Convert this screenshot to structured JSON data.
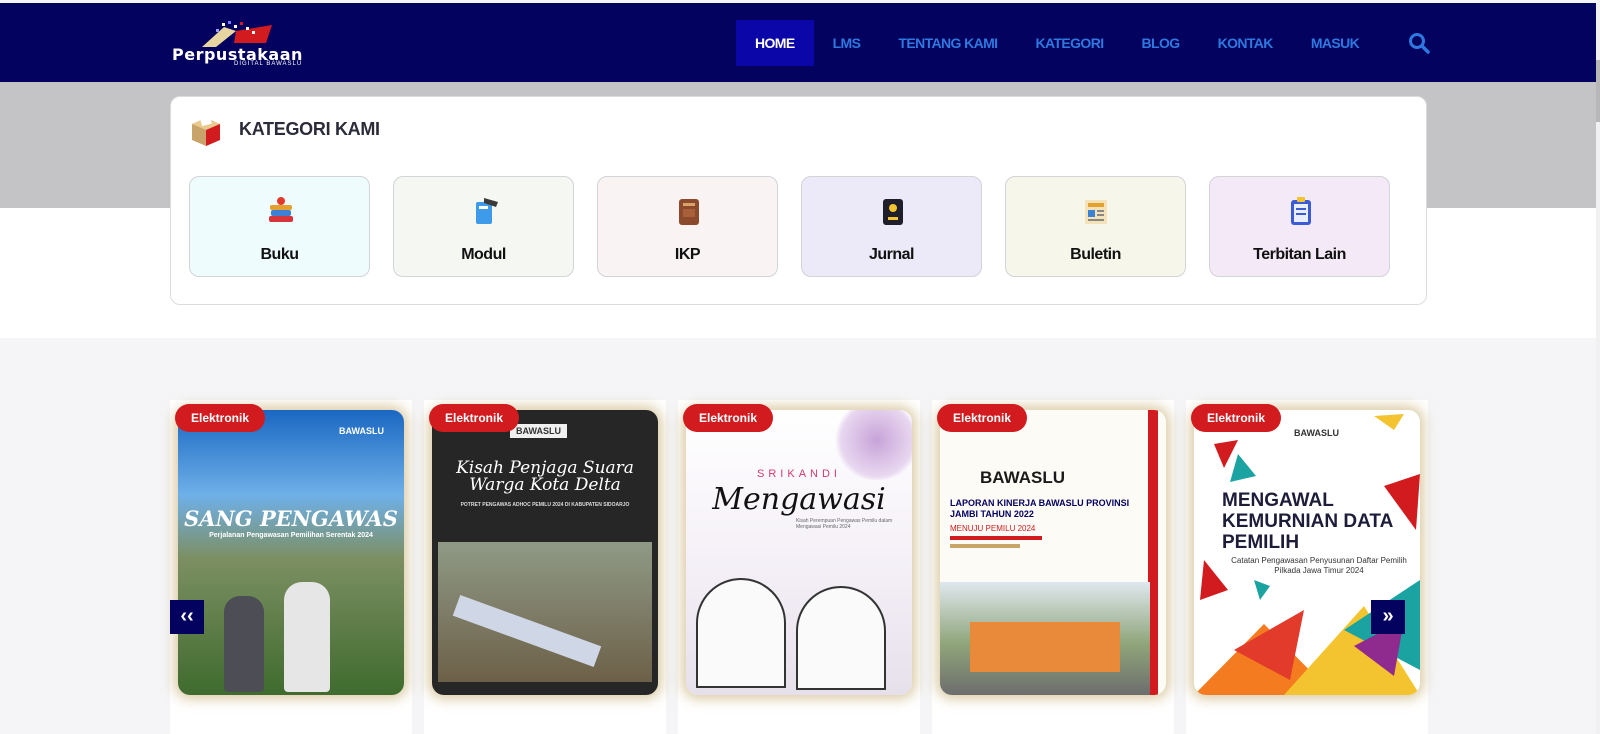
{
  "brand": {
    "name": "Perpustakaan",
    "subtitle": "DIGITAL BAWASLU"
  },
  "nav": {
    "items": [
      "HOME",
      "LMS",
      "TENTANG KAMI",
      "KATEGORI",
      "BLOG",
      "KONTAK",
      "MASUK"
    ],
    "active": "HOME",
    "search_icon": "search-icon"
  },
  "kategori": {
    "title": "KATEGORI KAMI",
    "icon": "ballot-box-icon",
    "items": [
      {
        "label": "Buku",
        "icon": "stacked-books-icon",
        "bg": "#eefcfd"
      },
      {
        "label": "Modul",
        "icon": "module-book-icon",
        "bg": "#f4f7f2"
      },
      {
        "label": "IKP",
        "icon": "brown-book-icon",
        "bg": "#faf3f4"
      },
      {
        "label": "Jurnal",
        "icon": "journal-icon",
        "bg": "#ece9f8"
      },
      {
        "label": "Buletin",
        "icon": "newspaper-icon",
        "bg": "#f6f7ea"
      },
      {
        "label": "Terbitan Lain",
        "icon": "clipboard-icon",
        "bg": "#f4e9f6"
      }
    ]
  },
  "books": {
    "badge": "Elektronik",
    "items": [
      {
        "title": "SANG PENGAWAS",
        "subtitle": "Perjalanan Pengawasan Pemilihan Serentak 2024",
        "brand": "BAWASLU"
      },
      {
        "title": "Kisah Penjaga Suara Warga Kota Delta",
        "subtitle": "POTRET PENGAWAS ADHOC PEMILU 2024 DI KABUPATEN SIDOARJO",
        "brand": "BAWASLU"
      },
      {
        "title": "Mengawasi",
        "kicker": "SRIKANDI",
        "subtitle": "Kisah Perempuan Pengawas Pemilu dalam Mengawasi Pemilu 2024"
      },
      {
        "title": "LAPORAN KINERJA BAWASLU PROVINSI JAMBI TAHUN 2022",
        "subtitle": "MENUJU PEMILU 2024",
        "brand": "BAWASLU"
      },
      {
        "title": "MENGAWAL KEMURNIAN DATA PEMILIH",
        "subtitle": "Catatan Pengawasan Penyusunan Daftar Pemilih Pilkada Jawa Timur 2024",
        "brand": "BAWASLU"
      }
    ],
    "prev_label": "‹‹",
    "next_label": "»"
  },
  "colors": {
    "header": "#04025f",
    "nav_link": "#2f78e0",
    "nav_active": "#0b06a8",
    "badge": "#d21b1f",
    "band": "#c4c4c6"
  }
}
